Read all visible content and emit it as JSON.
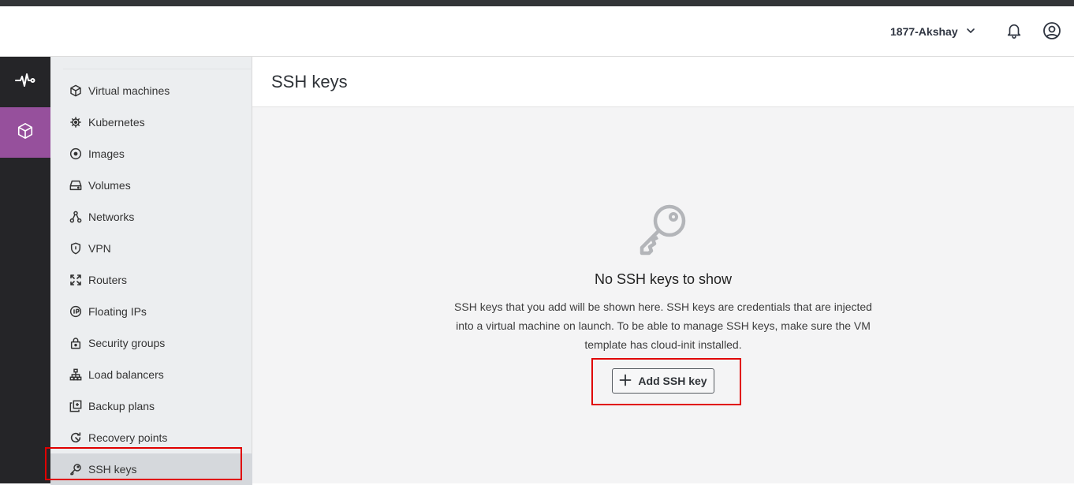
{
  "header": {
    "account_name": "1877-Akshay",
    "icons": [
      "chevron-down-icon",
      "bell-icon",
      "user-circle-icon"
    ]
  },
  "rail": {
    "items": [
      {
        "icon": "activity-icon",
        "active": false
      },
      {
        "icon": "cube-icon",
        "active": true
      }
    ],
    "active_color": "#96509c"
  },
  "sidebar": {
    "items": [
      {
        "label": "Virtual machines",
        "icon": "cube-icon"
      },
      {
        "label": "Kubernetes",
        "icon": "helm-icon"
      },
      {
        "label": "Images",
        "icon": "disc-icon"
      },
      {
        "label": "Volumes",
        "icon": "drive-icon"
      },
      {
        "label": "Networks",
        "icon": "network-icon"
      },
      {
        "label": "VPN",
        "icon": "shield-icon"
      },
      {
        "label": "Routers",
        "icon": "router-icon"
      },
      {
        "label": "Floating IPs",
        "icon": "floating-ip-icon"
      },
      {
        "label": "Security groups",
        "icon": "lock-icon"
      },
      {
        "label": "Load balancers",
        "icon": "sitemap-icon"
      },
      {
        "label": "Backup plans",
        "icon": "backup-icon"
      },
      {
        "label": "Recovery points",
        "icon": "recovery-icon"
      },
      {
        "label": "SSH keys",
        "icon": "key-icon",
        "selected": true
      }
    ]
  },
  "main": {
    "title": "SSH keys",
    "empty_state": {
      "icon": "key-icon",
      "title": "No SSH keys to show",
      "description": "SSH keys that you add will be shown here. SSH keys are credentials that are injected into a virtual machine on launch. To be able to manage SSH keys, make sure the VM template has cloud-init installed.",
      "button_label": "Add SSH key",
      "button_icon": "plus-icon"
    }
  },
  "colors": {
    "highlight": "#e00000",
    "rail_bg": "#252528",
    "sidebar_bg": "#eceef0",
    "selected_bg": "#d5d8dc"
  }
}
